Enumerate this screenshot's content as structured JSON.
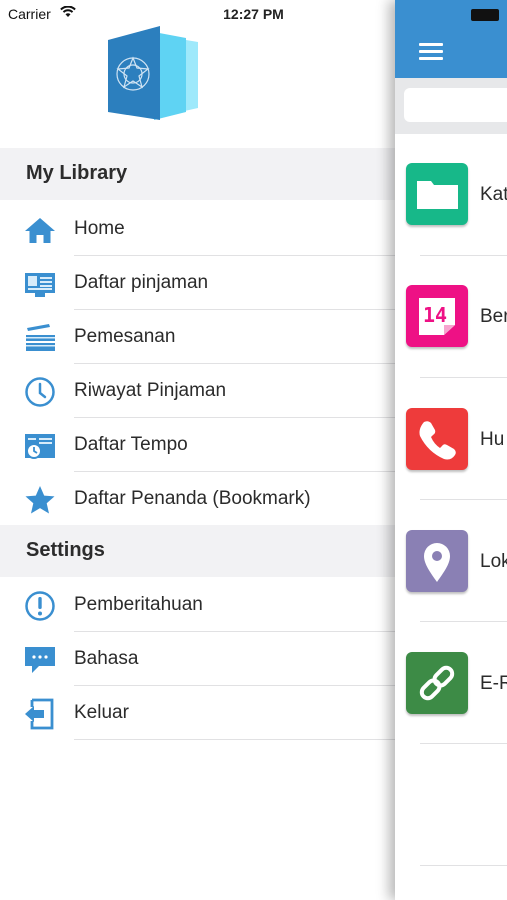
{
  "status_bar": {
    "carrier": "Carrier",
    "time": "12:27 PM"
  },
  "sections": {
    "library": {
      "title": "My Library"
    },
    "settings": {
      "title": "Settings"
    }
  },
  "menu": {
    "home": "Home",
    "daftar_pinjaman": "Daftar pinjaman",
    "pemesanan": "Pemesanan",
    "riwayat_pinjaman": "Riwayat Pinjaman",
    "daftar_tempo": "Daftar Tempo",
    "daftar_penanda": "Daftar Penanda (Bookmark)",
    "pemberitahuan": "Pemberitahuan",
    "bahasa": "Bahasa",
    "keluar": "Keluar"
  },
  "main": {
    "tiles": [
      {
        "label": "Kat",
        "color": "#17b889",
        "icon": "folder-icon"
      },
      {
        "label": "Ber",
        "color": "#ee1185",
        "icon": "calendar-icon"
      },
      {
        "label": "Hu",
        "color": "#ee3b3b",
        "icon": "phone-icon"
      },
      {
        "label": "Lok",
        "color": "#8a80b4",
        "icon": "map-pin-icon"
      },
      {
        "label": "E-R",
        "color": "#3d8b46",
        "icon": "link-icon"
      }
    ],
    "calendar_day": "14"
  },
  "colors": {
    "accent": "#3a8fd0",
    "icon_blue": "#3a8fd0"
  }
}
